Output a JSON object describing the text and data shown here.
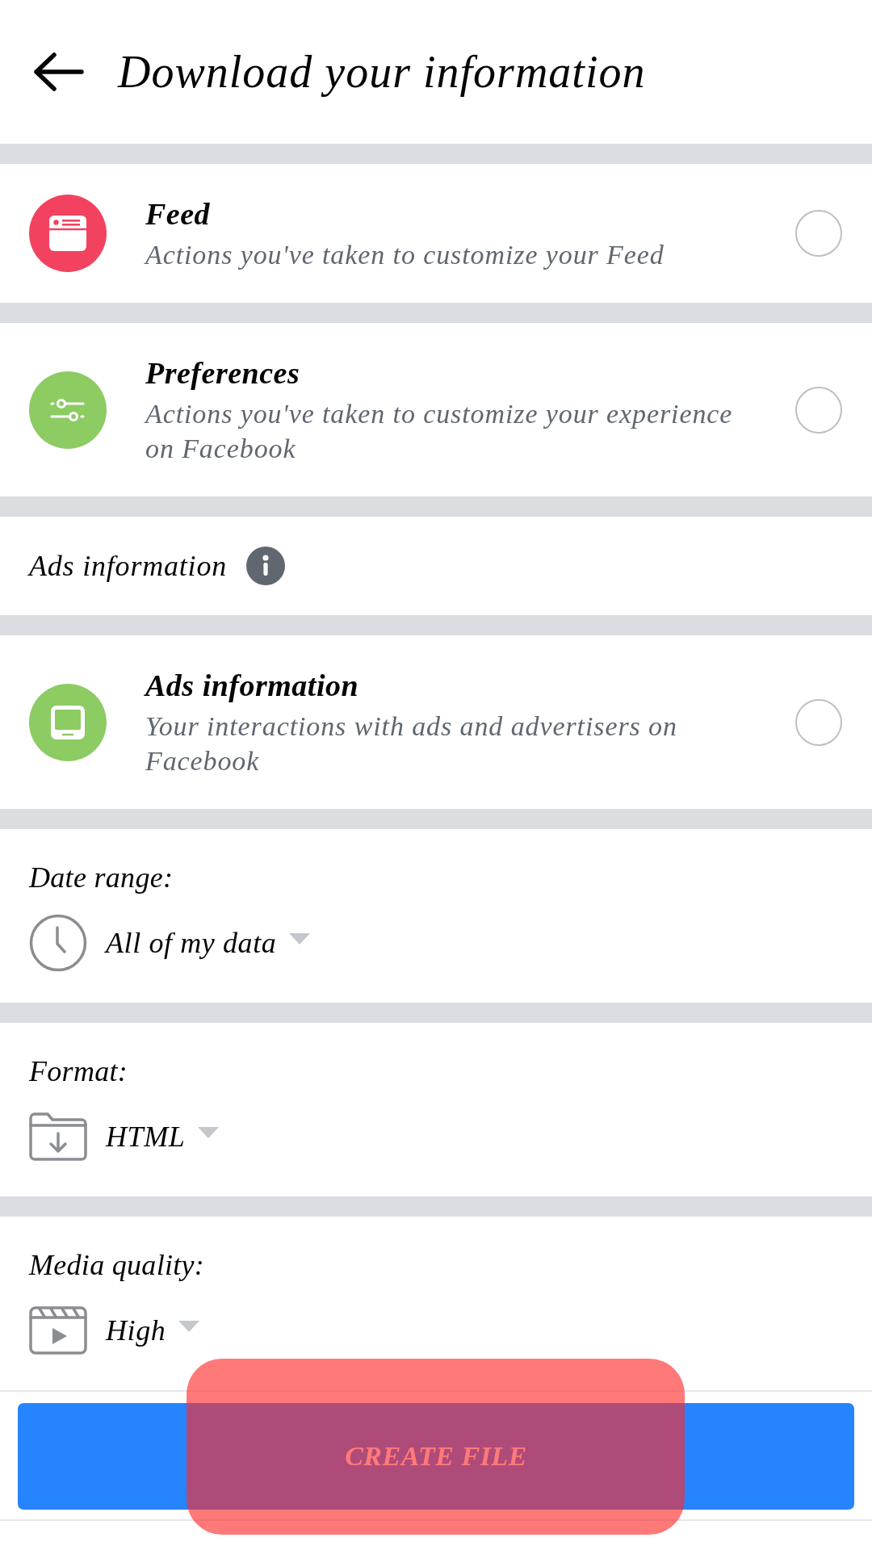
{
  "header": {
    "title": "Download your information"
  },
  "categories": [
    {
      "title": "Feed",
      "description": "Actions you've taken to customize your Feed",
      "color": "#f3425f",
      "selected": false
    },
    {
      "title": "Preferences",
      "description": "Actions you've taken to customize your experience on Facebook",
      "color": "#8dcb63",
      "selected": false
    }
  ],
  "ads_section": {
    "heading": "Ads information",
    "items": [
      {
        "title": "Ads information",
        "description": "Your interactions with ads and advertisers on Facebook",
        "color": "#8dcb63",
        "selected": false
      }
    ]
  },
  "options": [
    {
      "label": "Date range:",
      "value": "All of my data"
    },
    {
      "label": "Format:",
      "value": "HTML"
    },
    {
      "label": "Media quality:",
      "value": "High"
    }
  ],
  "create_file_button": {
    "label": "CREATE FILE",
    "highlighted": true
  }
}
